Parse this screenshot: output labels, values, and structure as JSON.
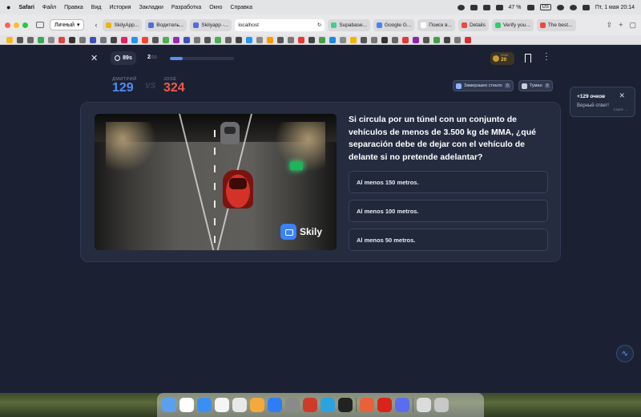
{
  "menubar": {
    "app": "Safari",
    "items": [
      "Файл",
      "Правка",
      "Вид",
      "История",
      "Закладки",
      "Разработка",
      "Окно",
      "Справка"
    ],
    "battery": "47 %",
    "keyboard": "US",
    "datetime": "Пт, 1 мая  20:14"
  },
  "browser": {
    "profile": "Личный",
    "tabs": [
      {
        "title": "SkilyApp...",
        "color": "#f5b20a"
      },
      {
        "title": "Водитель...",
        "color": "#4f6bdc"
      },
      {
        "title": "Skilyapp -...",
        "color": "#4f6bdc"
      },
      {
        "title": "localhost",
        "color": "#555555",
        "address": true
      },
      {
        "title": "Supabase...",
        "color": "#3ecf8e"
      },
      {
        "title": "Google G...",
        "color": "#4285f4"
      },
      {
        "title": "Поиск в...",
        "color": "#ffffff"
      },
      {
        "title": "Details",
        "color": "#e74c3c"
      },
      {
        "title": "Verify you...",
        "color": "#2ecc71"
      },
      {
        "title": "The best...",
        "color": "#e74c3c"
      }
    ]
  },
  "game": {
    "timer": "89s",
    "progress_current": "2",
    "progress_total": "/10",
    "progress_fraction": 0.2,
    "rank_label": "RANK",
    "rank_value": "20",
    "player_left": {
      "name": "ДМИТРИЙ",
      "score": "129"
    },
    "vs": "VS",
    "player_right": {
      "name": "JOSÉ",
      "score": "324"
    },
    "powerups": [
      {
        "label": "Замерзшее стекло",
        "count": "0"
      },
      {
        "label": "Туман",
        "count": "0"
      }
    ],
    "question": "Si circula por un túnel con un conjunto de vehículos de menos de 3.500 kg de MMA, ¿qué separación debe de dejar con el vehículo de delante si no pretende adelantar?",
    "answers": [
      "Al menos 150 metros.",
      "Al menos 100 metros.",
      "Al menos 50 metros."
    ],
    "image_brand": "Skily"
  },
  "toast": {
    "title": "+129 очков",
    "message": "Верный ответ!",
    "hint": "Свайп →"
  }
}
